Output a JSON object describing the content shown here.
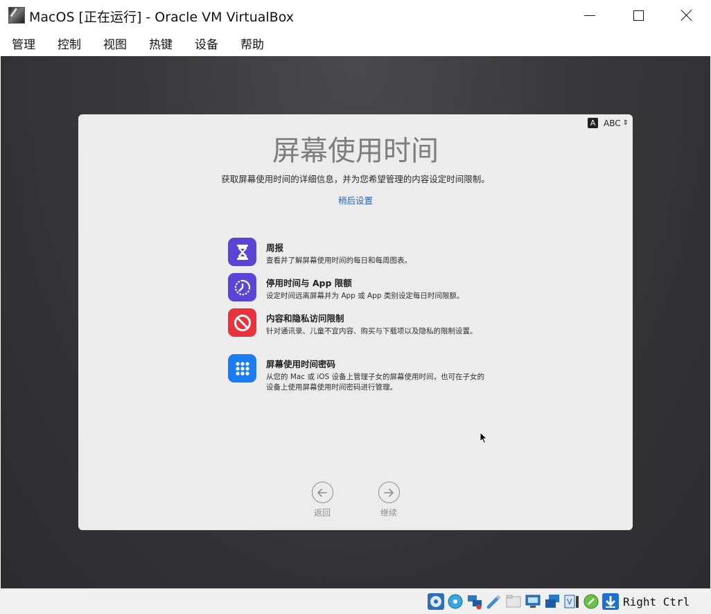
{
  "window": {
    "title": "MacOS [正在运行] - Oracle VM VirtualBox"
  },
  "menubar": {
    "items": [
      "管理",
      "控制",
      "视图",
      "热键",
      "设备",
      "帮助"
    ]
  },
  "setup": {
    "input_source": {
      "glyph": "A",
      "label": "ABC"
    },
    "title": "屏幕使用时间",
    "subtitle": "获取屏幕使用时间的详细信息，并为您希望管理的内容设定时间限制。",
    "later_link": "稍后设置",
    "features": [
      {
        "icon": "hourglass-icon",
        "color": "#5a45d6",
        "title": "周报",
        "description": "查看并了解屏幕使用时间的每日和每周图表。"
      },
      {
        "icon": "downtime-icon",
        "color": "#5a45d6",
        "title": "停用时间与 App 限额",
        "description": "设定时间远离屏幕并为 App 或 App 类别设定每日时间限额。"
      },
      {
        "icon": "no-entry-icon",
        "color": "#e8323c",
        "title": "内容和隐私访问限制",
        "description": "针对通讯录、儿童不宜内容、购买与下载项以及隐私的限制设置。"
      },
      {
        "icon": "keypad-icon",
        "color": "#1a7cf2",
        "title": "屏幕使用时间密码",
        "description": "从您的 Mac 或 iOS 设备上管理子女的屏幕使用时间，也可在子女的设备上使用屏幕使用时间密码进行管理。"
      }
    ],
    "back_label": "返回",
    "continue_label": "继续"
  },
  "statusbar": {
    "icons": [
      "hard-disk-icon",
      "optical-drive-icon",
      "network-icon",
      "usb-icon",
      "shared-folder-icon",
      "display-icon",
      "snapshot-icon",
      "video-capture-icon",
      "mouse-integration-icon",
      "host-key-arrow-icon"
    ],
    "host_key": "Right Ctrl"
  }
}
